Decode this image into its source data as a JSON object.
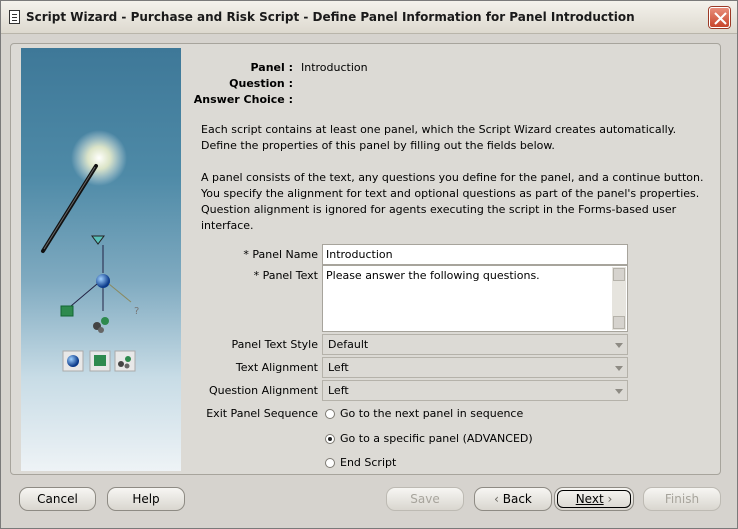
{
  "window": {
    "title": "Script Wizard - Purchase and Risk Script - Define Panel Information for Panel Introduction"
  },
  "info": {
    "panel_label": "Panel :",
    "panel_value": "Introduction",
    "question_label": "Question :",
    "answer_label": "Answer Choice :"
  },
  "description": {
    "para1": "Each script contains at least one panel, which the Script Wizard creates automatically. Define the properties of this panel by filling out the fields below.",
    "para2": "A panel consists of the text, any questions you define for the panel, and a continue button. You specify the alignment for text and optional questions as part of the panel's properties. Question alignment is ignored for agents executing the script in the Forms-based user interface."
  },
  "form": {
    "panel_name_label": "* Panel Name",
    "panel_name_value": "Introduction",
    "panel_text_label": "* Panel Text",
    "panel_text_value": "Please answer the following questions.",
    "panel_text_style_label": "Panel Text Style",
    "panel_text_style_value": "Default",
    "text_alignment_label": "Text Alignment",
    "text_alignment_value": "Left",
    "question_alignment_label": "Question Alignment",
    "question_alignment_value": "Left",
    "exit_sequence_label": "Exit Panel Sequence",
    "exit_options": [
      {
        "label": "Go to the next panel in sequence",
        "selected": false
      },
      {
        "label": "Go to a specific panel (ADVANCED)",
        "selected": true
      },
      {
        "label": "End Script",
        "selected": false
      }
    ]
  },
  "buttons": {
    "cancel": "Cancel",
    "help": "Help",
    "save": "Save",
    "back": "Back",
    "next": "Next",
    "finish": "Finish"
  }
}
